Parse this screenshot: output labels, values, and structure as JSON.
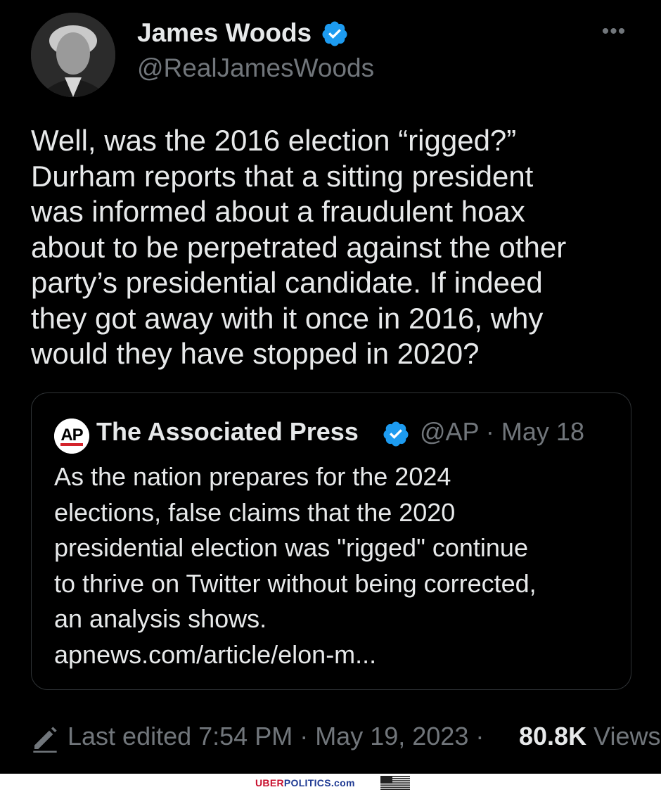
{
  "tweet": {
    "author": {
      "name": "James Woods",
      "handle": "@RealJamesWoods",
      "avatar_icon": "avatar-photo",
      "verified": true
    },
    "more_icon": "more-dots-icon",
    "text": "Well, was the 2016 election “rigged?”\nDurham reports that a sitting president\nwas informed about a fraudulent hoax\nabout to be perpetrated against the other\nparty’s presidential candidate. If indeed\nthey got away with it once in 2016, why\nwould they have stopped in 2020?",
    "quote": {
      "logo_text": "AP",
      "name": "The Associated Press",
      "verified": true,
      "meta": "@AP · May 18",
      "text": "As the nation prepares for the 2024\nelections, false claims that the 2020\npresidential election was \"rigged\" continue\nto thrive on Twitter without being corrected,\nan analysis shows.\napnews.com/article/elon-m..."
    },
    "footer": {
      "edit_icon": "pencil-icon",
      "edited_label": "Last edited 7:54 PM · May 19, 2023 · ",
      "views_count": "80.8K",
      "views_label": " Views"
    }
  },
  "watermark": {
    "brand_red": "UBER",
    "brand_blue": "POLITICS",
    "brand_suffix": ".com",
    "flag_icon": "us-flag-icon"
  },
  "colors": {
    "background": "#000000",
    "text_primary": "#e7e9ea",
    "text_secondary": "#71767b",
    "verified_blue": "#1d9bf0",
    "border": "#2f3336",
    "ap_red": "#d3222a"
  }
}
